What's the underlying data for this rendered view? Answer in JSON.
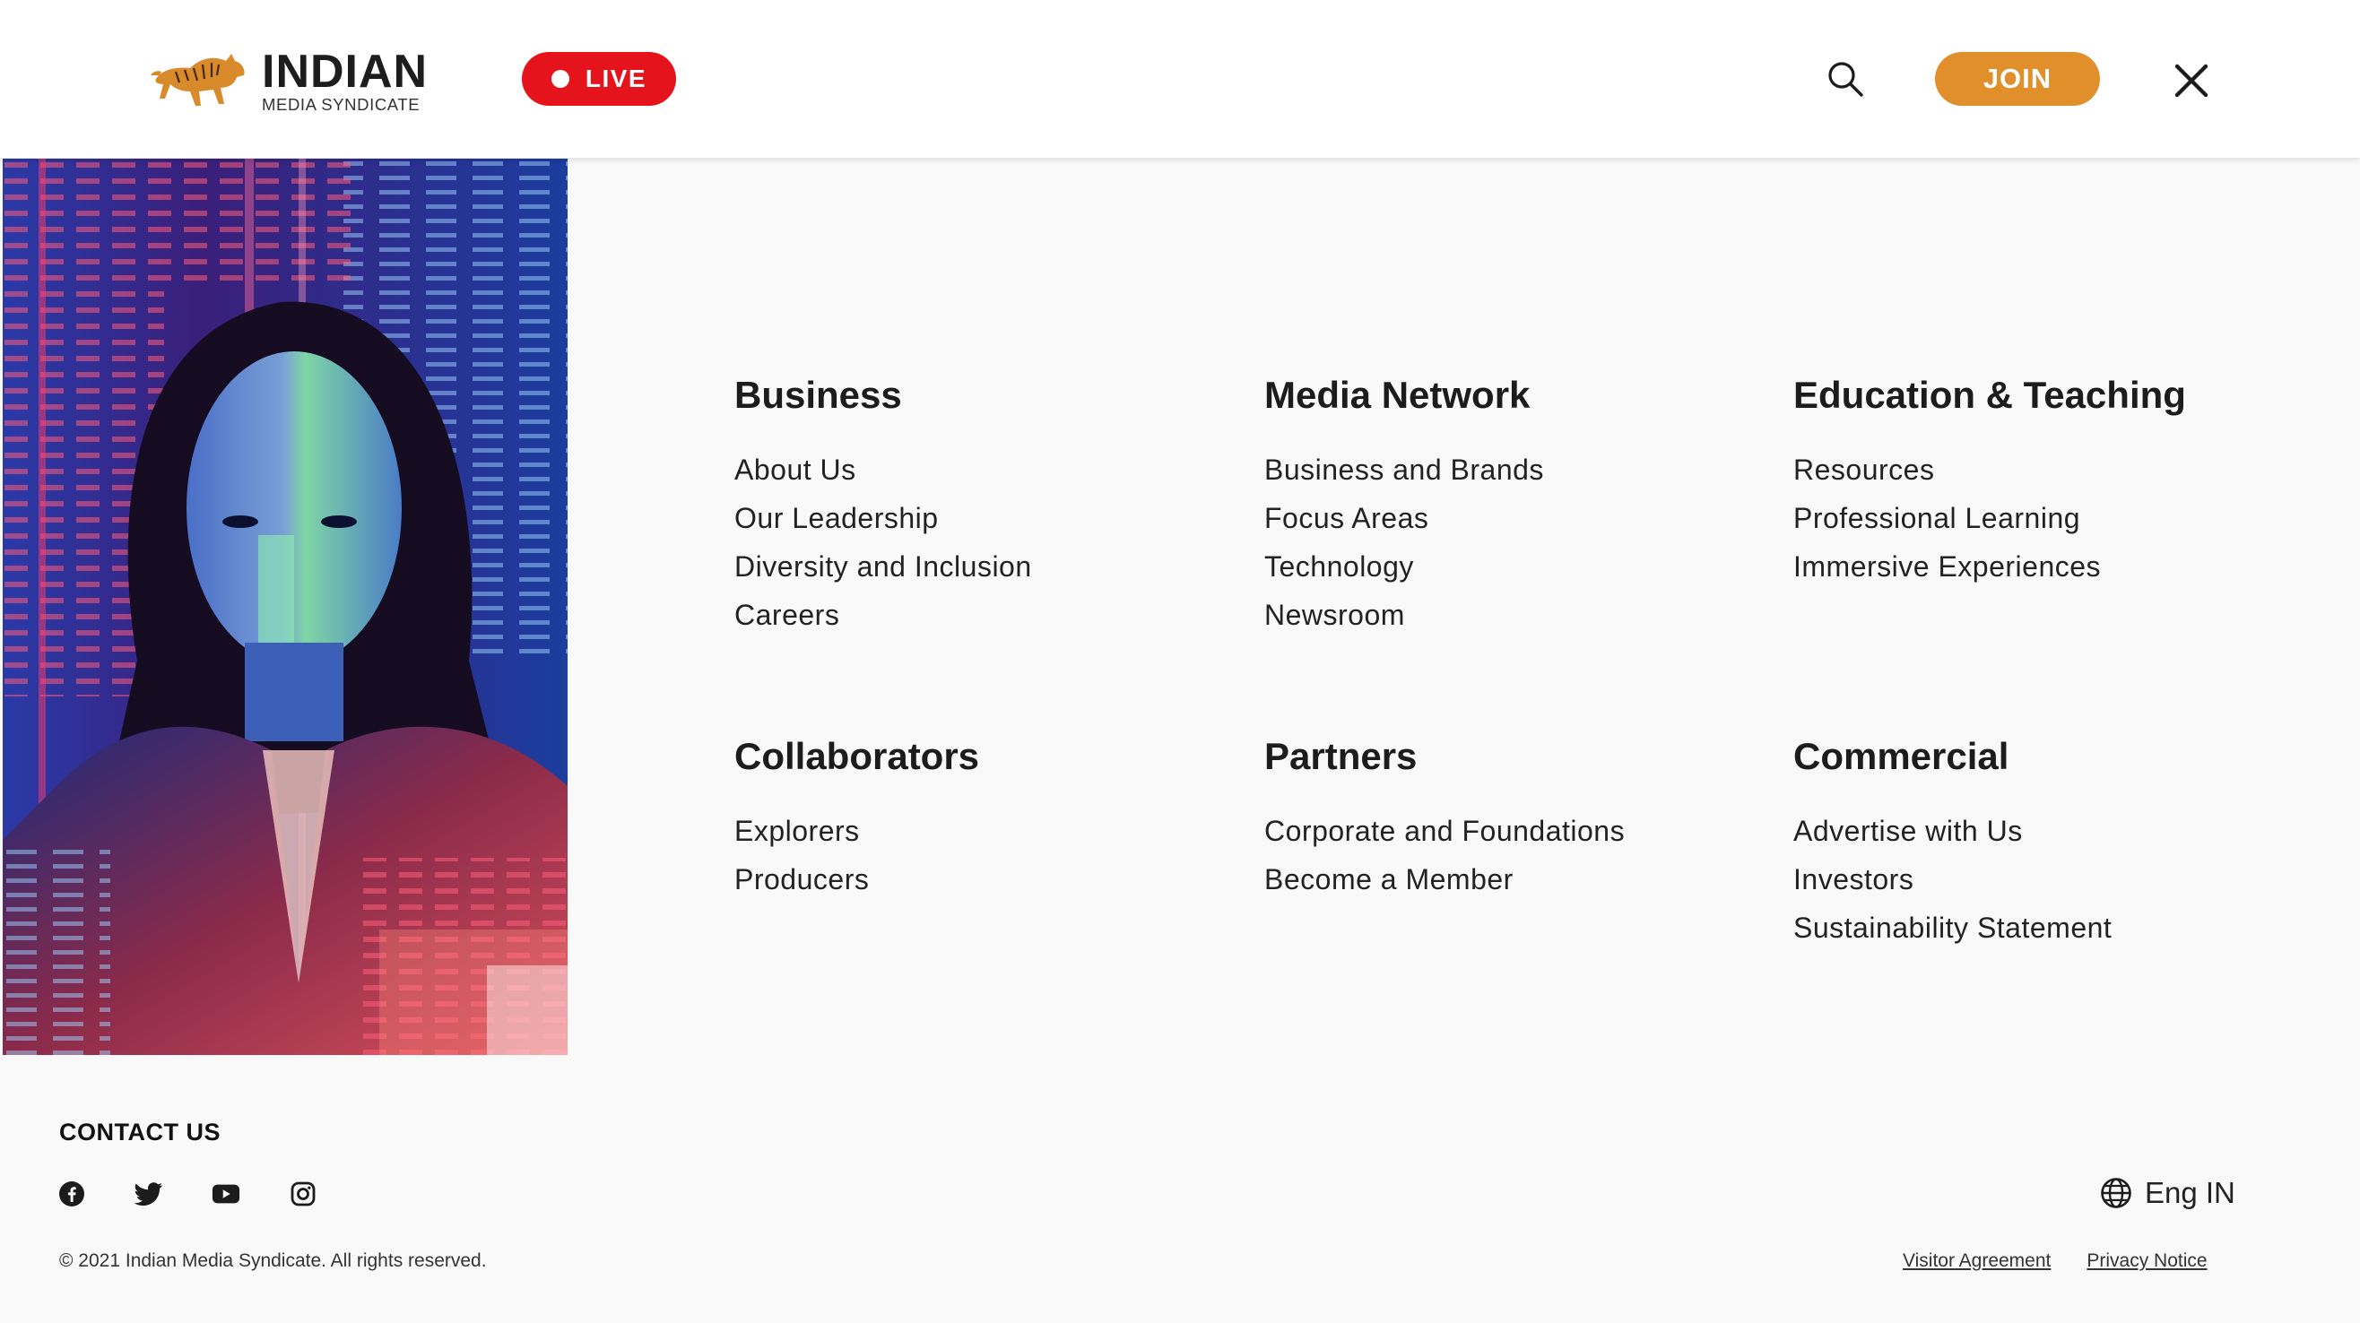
{
  "header": {
    "logo_main": "INDIAN",
    "logo_sub": "MEDIA SYNDICATE",
    "live_label": "LIVE",
    "join_label": "JOIN"
  },
  "menu": {
    "business": {
      "heading": "Business",
      "items": [
        "About Us",
        "Our Leadership",
        "Diversity and Inclusion",
        "Careers"
      ]
    },
    "media_network": {
      "heading": "Media Network",
      "items": [
        "Business and Brands",
        "Focus Areas",
        "Technology",
        "Newsroom"
      ]
    },
    "education": {
      "heading": "Education & Teaching",
      "items": [
        "Resources",
        "Professional Learning",
        "Immersive Experiences"
      ]
    },
    "collaborators": {
      "heading": "Collaborators",
      "items": [
        "Explorers",
        "Producers"
      ]
    },
    "partners": {
      "heading": "Partners",
      "items": [
        "Corporate and Foundations",
        "Become a Member"
      ]
    },
    "commercial": {
      "heading": "Commercial",
      "items": [
        "Advertise with Us",
        "Investors",
        "Sustainability Statement"
      ]
    }
  },
  "footer": {
    "contact_title": "CONTACT US",
    "social": [
      "facebook-icon",
      "twitter-icon",
      "youtube-icon",
      "instagram-icon"
    ],
    "copyright": "© 2021 Indian Media Syndicate. All rights reserved.",
    "language": "Eng IN",
    "links": [
      "Visitor Agreement",
      "Privacy Notice"
    ]
  },
  "colors": {
    "live_red": "#e5141c",
    "join_orange": "#e08f2a",
    "logo_orange": "#d98a2b",
    "background": "#f9f9f9"
  }
}
